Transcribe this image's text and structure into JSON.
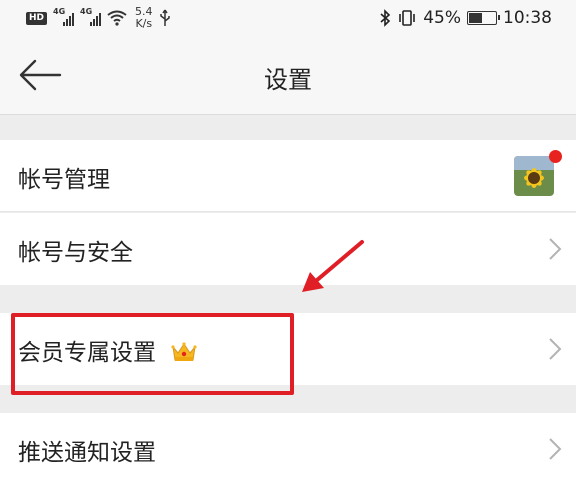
{
  "status_bar": {
    "hd_badge": "HD",
    "network_a": "4G",
    "network_b": "4G",
    "speed_value": "5.4",
    "speed_unit": "K/s",
    "battery_percent": "45%",
    "battery_level": 0.45,
    "time": "10:38"
  },
  "header": {
    "title": "设置"
  },
  "settings": {
    "account_management": "帐号管理",
    "account_security": "帐号与安全",
    "vip_settings": "会员专属设置",
    "push_notifications": "推送通知设置"
  },
  "colors": {
    "highlight": "#e01e25",
    "unread_dot": "#e8221e",
    "crown": "#f5b820"
  },
  "icons": {
    "back": "back-arrow-icon",
    "chevron": "chevron-right-icon",
    "crown": "crown-icon",
    "avatar": "sunflower-avatar"
  }
}
